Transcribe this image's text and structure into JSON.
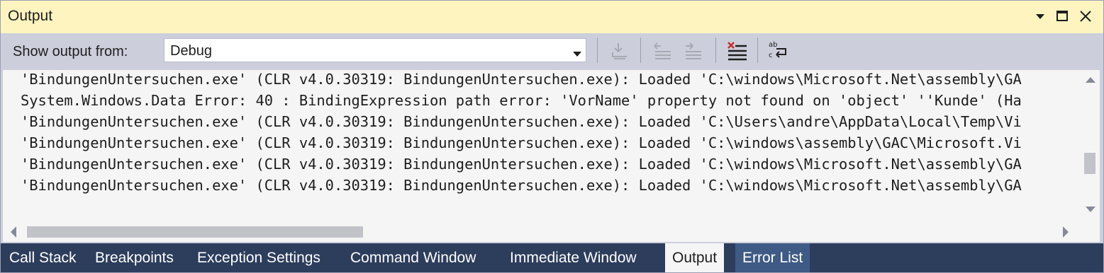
{
  "titlebar": {
    "title": "Output",
    "icons": [
      "dropdown-arrow-icon",
      "maximize-icon",
      "close-icon"
    ]
  },
  "toolbar": {
    "label": "Show output from:",
    "source_value": "Debug",
    "tools": [
      "find-message-in-code-icon",
      "previous-message-icon",
      "next-message-icon",
      "clear-all-icon",
      "toggle-word-wrap-icon"
    ]
  },
  "output": {
    "lines": [
      "'BindungenUntersuchen.exe' (CLR v4.0.30319: BindungenUntersuchen.exe): Loaded 'C:\\windows\\Microsoft.Net\\assembly\\GA",
      "System.Windows.Data Error: 40 : BindingExpression path error: 'VorName' property not found on 'object' ''Kunde' (Ha",
      "'BindungenUntersuchen.exe' (CLR v4.0.30319: BindungenUntersuchen.exe): Loaded 'C:\\Users\\andre\\AppData\\Local\\Temp\\Vi",
      "'BindungenUntersuchen.exe' (CLR v4.0.30319: BindungenUntersuchen.exe): Loaded 'C:\\windows\\assembly\\GAC\\Microsoft.Vi",
      "'BindungenUntersuchen.exe' (CLR v4.0.30319: BindungenUntersuchen.exe): Loaded 'C:\\windows\\Microsoft.Net\\assembly\\GA",
      "'BindungenUntersuchen.exe' (CLR v4.0.30319: BindungenUntersuchen.exe): Loaded 'C:\\windows\\Microsoft.Net\\assembly\\GA"
    ]
  },
  "tabs": [
    {
      "label": "Call Stack",
      "active": false
    },
    {
      "label": "Breakpoints",
      "active": false
    },
    {
      "label": "Exception Settings",
      "active": false
    },
    {
      "label": "Command Window",
      "active": false
    },
    {
      "label": "Immediate Window",
      "active": false
    },
    {
      "label": "Output",
      "active": true
    },
    {
      "label": "Error List",
      "active": false
    }
  ],
  "colors": {
    "titlebar_bg": "#fdf4bf",
    "toolbar_bg": "#cccedb",
    "tabstrip_bg": "#2d3d5c",
    "content_bg": "#f5f5f5"
  }
}
